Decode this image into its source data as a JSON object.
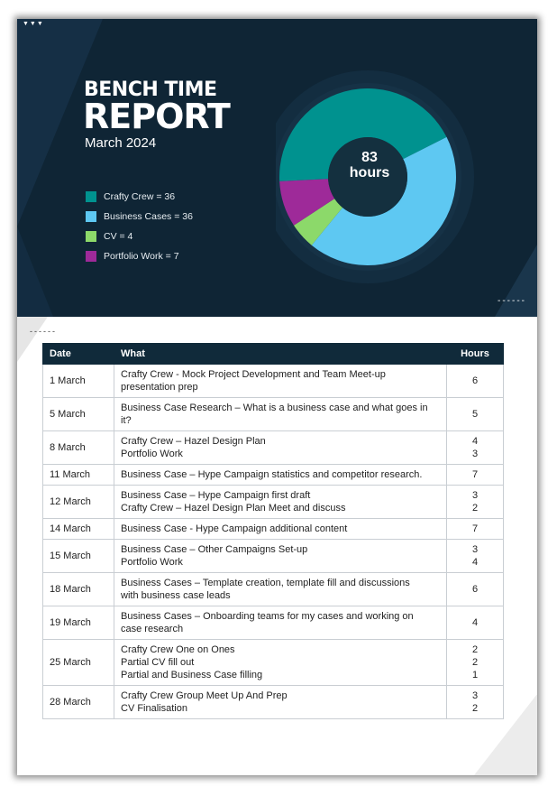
{
  "header": {
    "dots": "▼▼▼",
    "title_line1": "BENCH TIME",
    "title_line2": "REPORT",
    "subtitle": "March 2024",
    "corner_dashes": "------",
    "left_dashes": "------"
  },
  "chart_data": {
    "type": "pie",
    "style": "donut",
    "center_value": "83",
    "center_unit": "hours",
    "series": [
      {
        "name": "Crafty Crew",
        "value": 36,
        "color": "#00928f",
        "label": "Crafty Crew = 36"
      },
      {
        "name": "Business Cases",
        "value": 36,
        "color": "#5ec8f2",
        "label": "Business Cases = 36"
      },
      {
        "name": "CV",
        "value": 4,
        "color": "#8cd96a",
        "label": "CV = 4"
      },
      {
        "name": "Portfolio Work",
        "value": 7,
        "color": "#9e2a99",
        "label": "Portfolio Work = 7"
      }
    ]
  },
  "table": {
    "headers": {
      "date": "Date",
      "what": "What",
      "hours": "Hours"
    },
    "rows": [
      {
        "date": "1 March",
        "what": [
          "Crafty Crew -  Mock Project Development and Team Meet-up",
          "presentation prep"
        ],
        "hours": [
          "6"
        ]
      },
      {
        "date": "5 March",
        "what": [
          "Business Case Research – What is a business case and what goes in",
          "it?"
        ],
        "hours": [
          "5"
        ]
      },
      {
        "date": "8 March",
        "what": [
          "Crafty Crew – Hazel Design Plan",
          "Portfolio Work"
        ],
        "hours": [
          "4",
          "3"
        ]
      },
      {
        "date": "11 March",
        "what": [
          "Business Case – Hype Campaign statistics and competitor research."
        ],
        "hours": [
          "7"
        ]
      },
      {
        "date": "12 March",
        "what": [
          "Business Case – Hype Campaign first draft",
          "Crafty Crew – Hazel Design Plan Meet and discuss"
        ],
        "hours": [
          "3",
          "2"
        ]
      },
      {
        "date": "14 March",
        "what": [
          "Business Case - Hype Campaign additional content"
        ],
        "hours": [
          "7"
        ]
      },
      {
        "date": "15 March",
        "what": [
          "Business Case – Other Campaigns Set-up",
          "Portfolio Work"
        ],
        "hours": [
          "3",
          "4"
        ]
      },
      {
        "date": "18 March",
        "what": [
          "Business Cases – Template creation, template fill and discussions",
          "with business case leads"
        ],
        "hours": [
          "6"
        ]
      },
      {
        "date": "19 March",
        "what": [
          "Business Cases – Onboarding teams for my cases and working on",
          "case research"
        ],
        "hours": [
          "4"
        ]
      },
      {
        "date": "25 March",
        "what": [
          "Crafty Crew One on Ones",
          "Partial CV fill out",
          "Partial and Business Case filling"
        ],
        "hours": [
          "2",
          "2",
          "1"
        ]
      },
      {
        "date": "28 March",
        "what": [
          "Crafty Crew Group Meet Up And Prep",
          "CV Finalisation"
        ],
        "hours": [
          "3",
          "2"
        ]
      }
    ]
  }
}
